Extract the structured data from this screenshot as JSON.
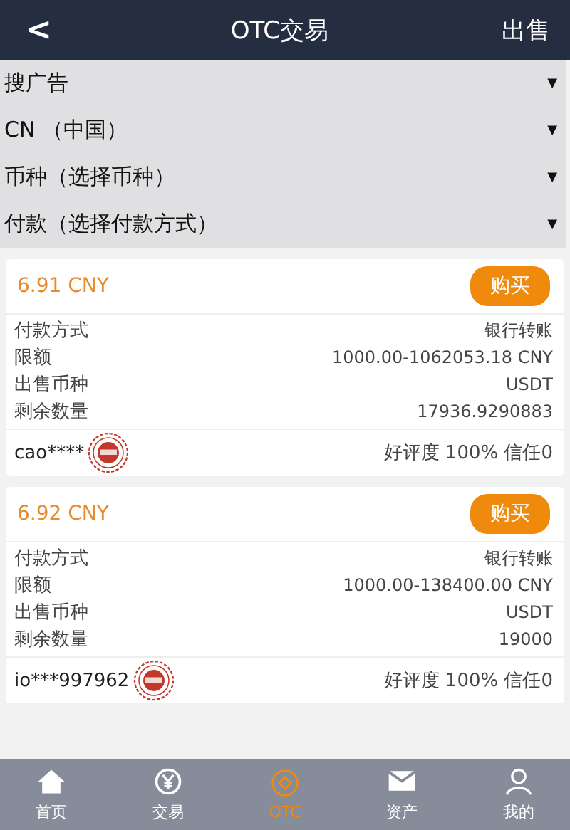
{
  "header": {
    "back": "<",
    "title": "OTC交易",
    "action": "出售"
  },
  "filters": [
    {
      "label": "搜广告",
      "caret": "▼"
    },
    {
      "label": "CN （中国）",
      "caret": "▼"
    },
    {
      "label": "币种（选择币种）",
      "caret": "▼"
    },
    {
      "label": "付款（选择付款方式）",
      "caret": "▼"
    }
  ],
  "offers": [
    {
      "price": "6.91 CNY",
      "button": "购买",
      "fields": [
        {
          "label": "付款方式",
          "value": "银行转账"
        },
        {
          "label": "限额",
          "value": "1000.00-1062053.18 CNY"
        },
        {
          "label": "出售币种",
          "value": "USDT"
        },
        {
          "label": "剩余数量",
          "value": "17936.9290883"
        }
      ],
      "seller": "cao****",
      "rating": "好评度 100%  信任0"
    },
    {
      "price": "6.92 CNY",
      "button": "购买",
      "fields": [
        {
          "label": "付款方式",
          "value": "银行转账"
        },
        {
          "label": "限额",
          "value": "1000.00-138400.00 CNY"
        },
        {
          "label": "出售币种",
          "value": "USDT"
        },
        {
          "label": "剩余数量",
          "value": "19000"
        }
      ],
      "seller": "io***997962",
      "rating": "好评度 100%  信任0"
    }
  ],
  "nav": [
    {
      "label": "首页",
      "kind": "home",
      "selected": false
    },
    {
      "label": "交易",
      "kind": "trade",
      "selected": false
    },
    {
      "label": "OTC",
      "kind": "otc",
      "selected": true
    },
    {
      "label": "资产",
      "kind": "assets",
      "selected": false
    },
    {
      "label": "我的",
      "kind": "profile",
      "selected": false
    }
  ]
}
